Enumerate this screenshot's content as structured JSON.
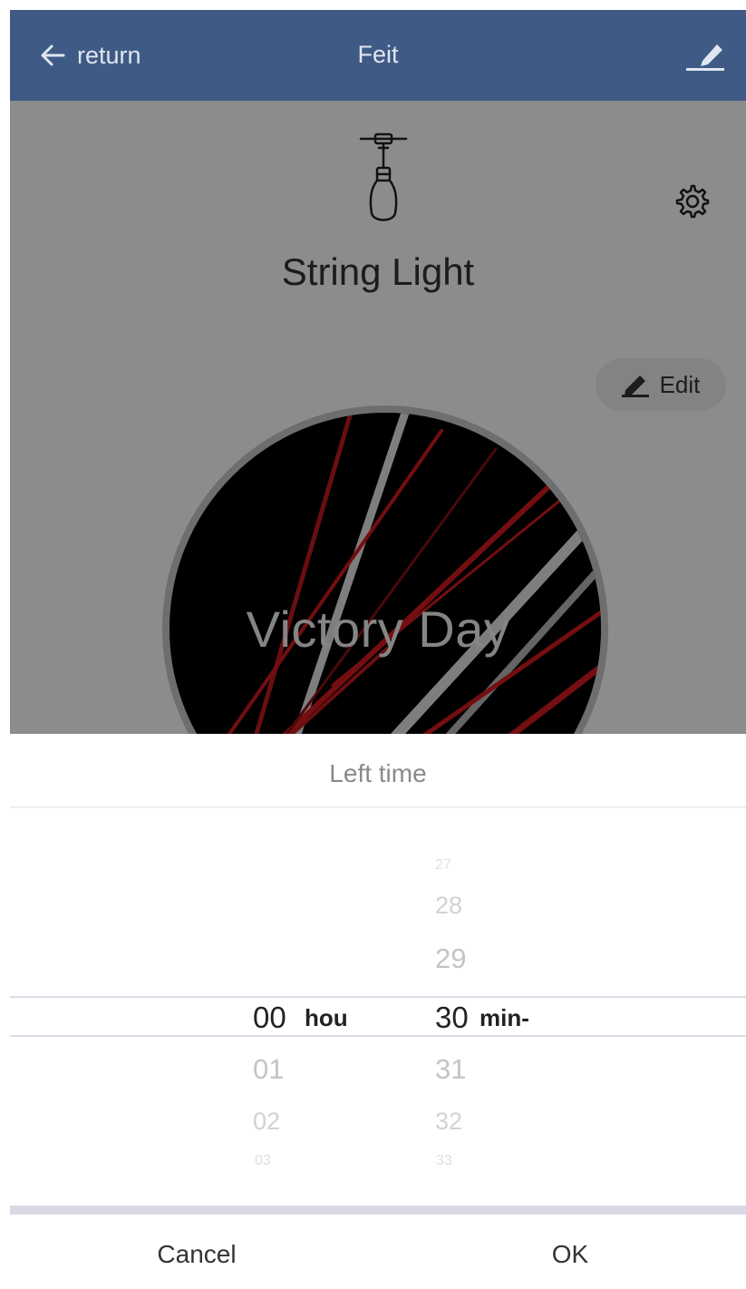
{
  "header": {
    "back_label": "return",
    "title": "Feit"
  },
  "device": {
    "name": "String Light",
    "edit_label": "Edit",
    "scene_name": "Victory Day"
  },
  "timer_sheet": {
    "title": "Left time",
    "hours": {
      "above": [],
      "selected": "00",
      "unit": "hou",
      "below": [
        "01",
        "02",
        "03"
      ]
    },
    "minutes": {
      "above": [
        "27",
        "28",
        "29"
      ],
      "selected": "30",
      "unit": "min-",
      "below": [
        "31",
        "32",
        "33"
      ]
    },
    "cancel_label": "Cancel",
    "ok_label": "OK"
  },
  "colors": {
    "header_bg": "#3f5a85",
    "scene_red": "#d41a1f",
    "scene_white": "#e6e6e6",
    "picker_line": "#dcdce6"
  },
  "icons": {
    "back": "arrow-left-icon",
    "edit_name": "pencil-underline-icon",
    "device": "string-light-bulb-icon",
    "settings": "gear-icon",
    "edit": "pencil-icon"
  }
}
